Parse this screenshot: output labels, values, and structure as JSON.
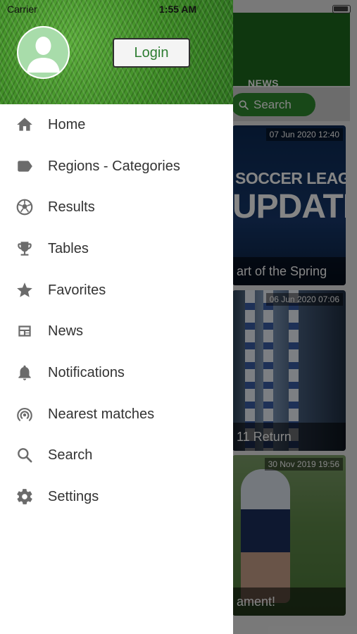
{
  "status_bar": {
    "carrier": "Carrier",
    "time": "1:55 AM"
  },
  "background": {
    "tab_label": "NEWS",
    "search_label": "Search",
    "cards": [
      {
        "date": "07 Jun 2020 12:40",
        "promo_line1": "SOCCER LEAGUE",
        "promo_line2": "UPDATE",
        "caption": "art of the Spring"
      },
      {
        "date": "06 Jun 2020 07:06",
        "caption": "11 Return"
      },
      {
        "date": "30 Nov 2019 19:56",
        "caption": "ament!"
      }
    ]
  },
  "drawer": {
    "login_label": "Login",
    "menu": [
      {
        "label": "Home",
        "icon": "home-icon"
      },
      {
        "label": "Regions - Categories",
        "icon": "label-tag-icon"
      },
      {
        "label": "Results",
        "icon": "soccer-ball-icon"
      },
      {
        "label": "Tables",
        "icon": "trophy-icon"
      },
      {
        "label": "Favorites",
        "icon": "star-icon"
      },
      {
        "label": "News",
        "icon": "newspaper-icon"
      },
      {
        "label": "Notifications",
        "icon": "bell-icon"
      },
      {
        "label": "Nearest matches",
        "icon": "location-signal-icon"
      },
      {
        "label": "Search",
        "icon": "search-icon"
      },
      {
        "label": "Settings",
        "icon": "gear-icon"
      }
    ]
  },
  "colors": {
    "header_green": "#1e6a1e",
    "accent_green": "#2e7d32",
    "icon_gray": "#6b6b6b",
    "text": "#333333"
  }
}
